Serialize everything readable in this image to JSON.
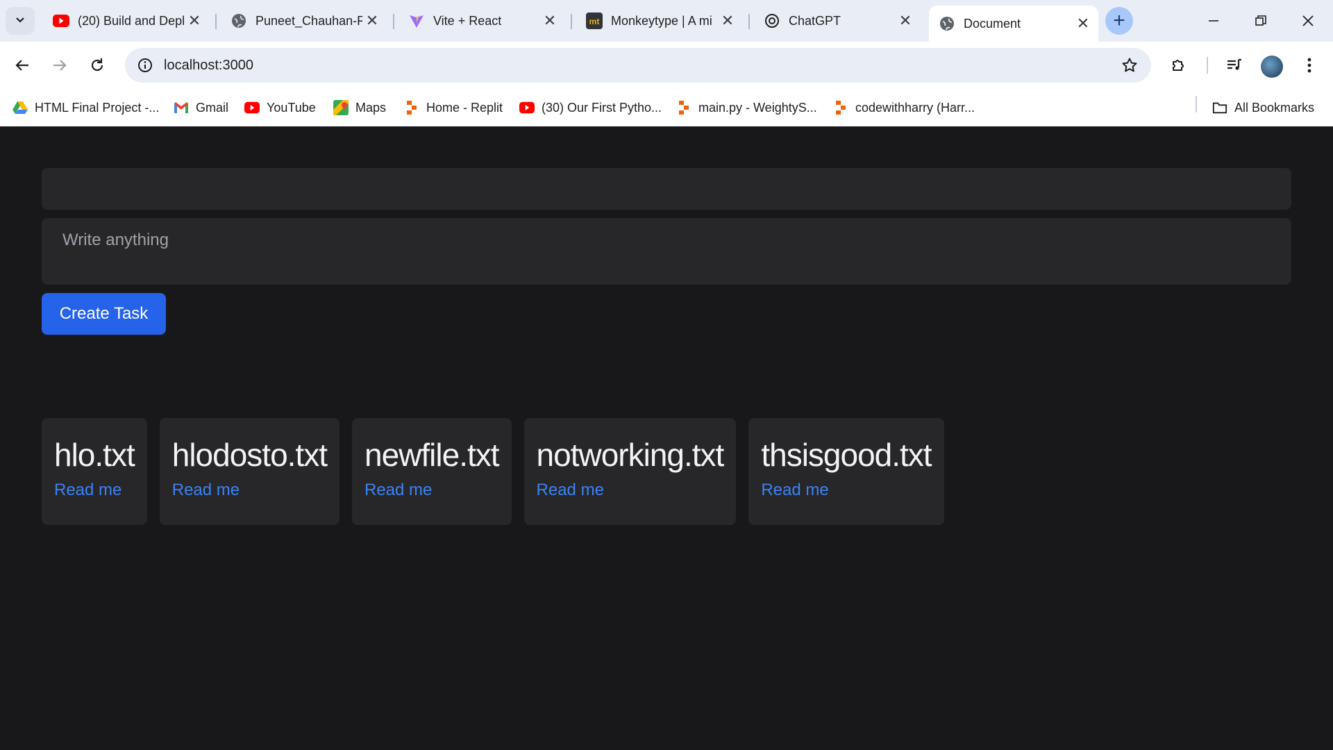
{
  "browser": {
    "tabs": [
      {
        "title": "(20) Build and Depl",
        "icon": "youtube-icon"
      },
      {
        "title": "Puneet_Chauhan-F",
        "icon": "globe-icon"
      },
      {
        "title": "Vite + React",
        "icon": "vite-icon"
      },
      {
        "title": "Monkeytype | A mi",
        "icon": "monkeytype-icon"
      },
      {
        "title": "ChatGPT",
        "icon": "chatgpt-icon"
      },
      {
        "title": "Document",
        "icon": "globe-icon",
        "active": true
      }
    ],
    "url": "localhost:3000",
    "bookmarks": [
      {
        "label": "HTML Final Project -...",
        "icon": "google-drive-icon"
      },
      {
        "label": "Gmail",
        "icon": "gmail-icon"
      },
      {
        "label": "YouTube",
        "icon": "youtube-icon"
      },
      {
        "label": "Maps",
        "icon": "maps-icon"
      },
      {
        "label": "Home - Replit",
        "icon": "replit-icon"
      },
      {
        "label": "(30) Our First Pytho...",
        "icon": "youtube-icon"
      },
      {
        "label": "main.py - WeightyS...",
        "icon": "replit-icon"
      },
      {
        "label": "codewithharry (Harr...",
        "icon": "replit-icon"
      }
    ],
    "all_bookmarks_label": "All Bookmarks"
  },
  "app": {
    "title_value": "",
    "description_placeholder": "Write anything",
    "create_button_label": "Create Task",
    "files": [
      {
        "name": "hlo.txt",
        "link": "Read me"
      },
      {
        "name": "hlodosto.txt",
        "link": "Read me"
      },
      {
        "name": "newfile.txt",
        "link": "Read me"
      },
      {
        "name": "notworking.txt",
        "link": "Read me"
      },
      {
        "name": "thsisgood.txt",
        "link": "Read me"
      }
    ]
  },
  "colors": {
    "page_background": "#18181b",
    "card_background": "#27272a",
    "accent_blue": "#2563eb",
    "link_blue": "#3b82f6"
  }
}
